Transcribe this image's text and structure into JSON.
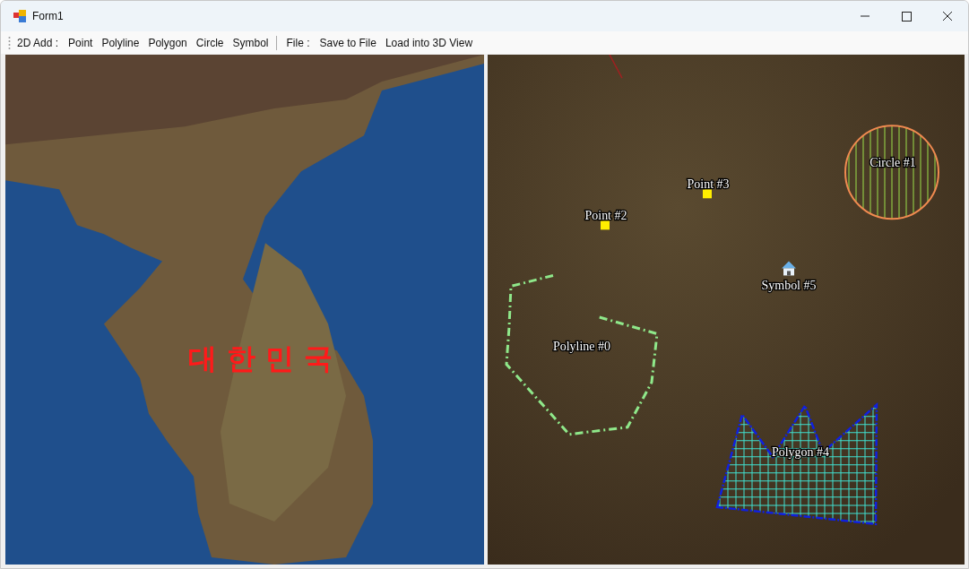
{
  "window": {
    "title": "Form1"
  },
  "toolbar": [
    {
      "label": "2D Add :",
      "items": [
        "Point",
        "Polyline",
        "Polygon",
        "Circle",
        "Symbol"
      ]
    },
    {
      "label": "File :",
      "items": [
        "Save to File",
        "Load into 3D View"
      ]
    }
  ],
  "map_2d": {
    "label": "대 한 민 국"
  },
  "map_canvas": {
    "features": [
      {
        "kind": "polyline",
        "label": "Polyline #0"
      },
      {
        "kind": "circle",
        "label": "Circle #1"
      },
      {
        "kind": "point",
        "label": "Point #2"
      },
      {
        "kind": "point",
        "label": "Point #3"
      },
      {
        "kind": "polygon",
        "label": "Polygon #4"
      },
      {
        "kind": "symbol",
        "label": "Symbol #5"
      }
    ]
  }
}
